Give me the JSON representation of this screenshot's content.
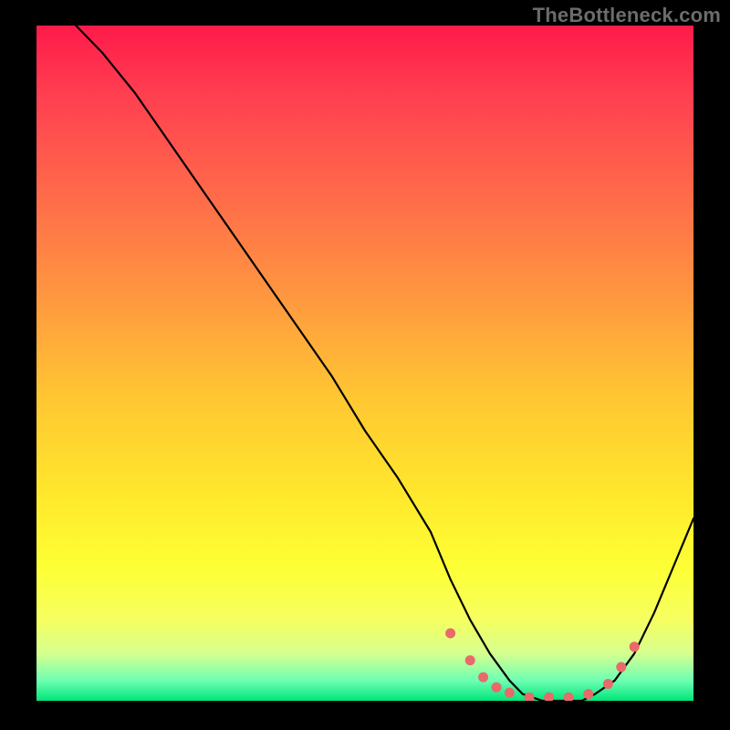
{
  "watermark": "TheBottleneck.com",
  "chart_data": {
    "type": "line",
    "title": "",
    "xlabel": "",
    "ylabel": "",
    "xlim": [
      0,
      100
    ],
    "ylim": [
      0,
      100
    ],
    "grid": false,
    "legend": false,
    "series": [
      {
        "name": "bottleneck-curve",
        "x": [
          6,
          10,
          15,
          20,
          25,
          30,
          35,
          40,
          45,
          50,
          55,
          60,
          63,
          66,
          69,
          72,
          74,
          77,
          80,
          83,
          85,
          88,
          91,
          94,
          97,
          100
        ],
        "y": [
          100,
          96,
          90,
          83,
          76,
          69,
          62,
          55,
          48,
          40,
          33,
          25,
          18,
          12,
          7,
          3,
          1,
          0,
          0,
          0,
          1,
          3,
          7,
          13,
          20,
          27
        ]
      }
    ],
    "annotations": {
      "bottom_band_markers": {
        "name": "optimal-range-dots",
        "points": [
          {
            "x": 63,
            "y": 10
          },
          {
            "x": 66,
            "y": 6
          },
          {
            "x": 68,
            "y": 3.5
          },
          {
            "x": 70,
            "y": 2
          },
          {
            "x": 72,
            "y": 1.2
          },
          {
            "x": 75,
            "y": 0.5
          },
          {
            "x": 78,
            "y": 0.5
          },
          {
            "x": 81,
            "y": 0.5
          },
          {
            "x": 84,
            "y": 1
          },
          {
            "x": 87,
            "y": 2.5
          },
          {
            "x": 89,
            "y": 5
          },
          {
            "x": 91,
            "y": 8
          }
        ],
        "color": "#e86a6a"
      }
    },
    "gradient_stops": [
      {
        "pct": 0,
        "color": "#ff1a4a"
      },
      {
        "pct": 25,
        "color": "#ff6a4a"
      },
      {
        "pct": 55,
        "color": "#ffc632"
      },
      {
        "pct": 80,
        "color": "#fdff34"
      },
      {
        "pct": 97,
        "color": "#6dffb2"
      },
      {
        "pct": 100,
        "color": "#00e57a"
      }
    ]
  }
}
